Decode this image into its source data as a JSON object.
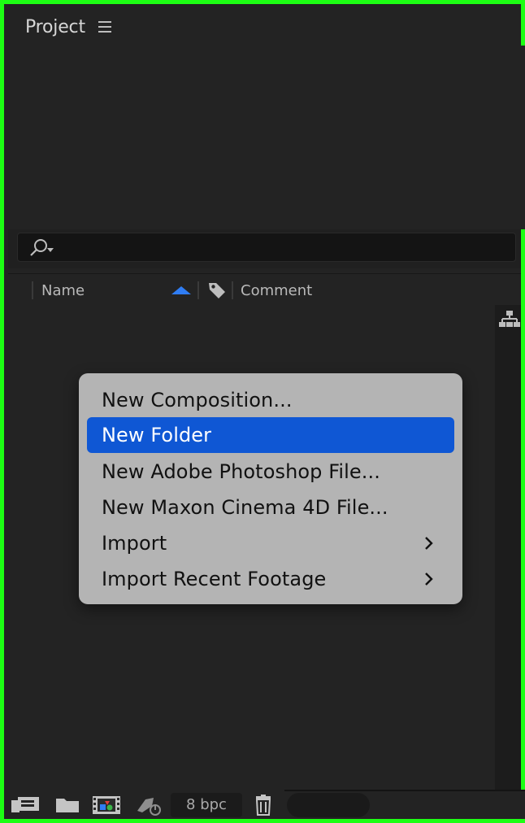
{
  "panel": {
    "title": "Project",
    "menu_icon": "hamburger-menu-icon"
  },
  "search": {
    "icon": "search-icon",
    "placeholder": "",
    "value": ""
  },
  "columns": {
    "name": "Name",
    "comment": "Comment",
    "sort_direction": "ascending",
    "sort_icon_color": "#2f7df4",
    "label_icon": "tag-icon"
  },
  "side_icon": "flowchart-icon",
  "context_menu": {
    "items": [
      {
        "label": "New Composition...",
        "has_submenu": false,
        "selected": false
      },
      {
        "label": "New Folder",
        "has_submenu": false,
        "selected": true
      },
      {
        "label": "New Adobe Photoshop File...",
        "has_submenu": false,
        "selected": false
      },
      {
        "label": "New Maxon Cinema 4D File...",
        "has_submenu": false,
        "selected": false
      },
      {
        "label": "Import",
        "has_submenu": true,
        "selected": false
      },
      {
        "label": "Import Recent Footage",
        "has_submenu": true,
        "selected": false
      }
    ],
    "highlight_color": "#0f57d4"
  },
  "bottom_bar": {
    "icons": [
      "interpret-footage-icon",
      "new-folder-icon",
      "new-composition-icon",
      "render-queue-icon",
      "delete-icon"
    ],
    "bpc_label": "8 bpc"
  },
  "colors": {
    "frame_border": "#1dfe14",
    "panel_bg": "#232323"
  }
}
